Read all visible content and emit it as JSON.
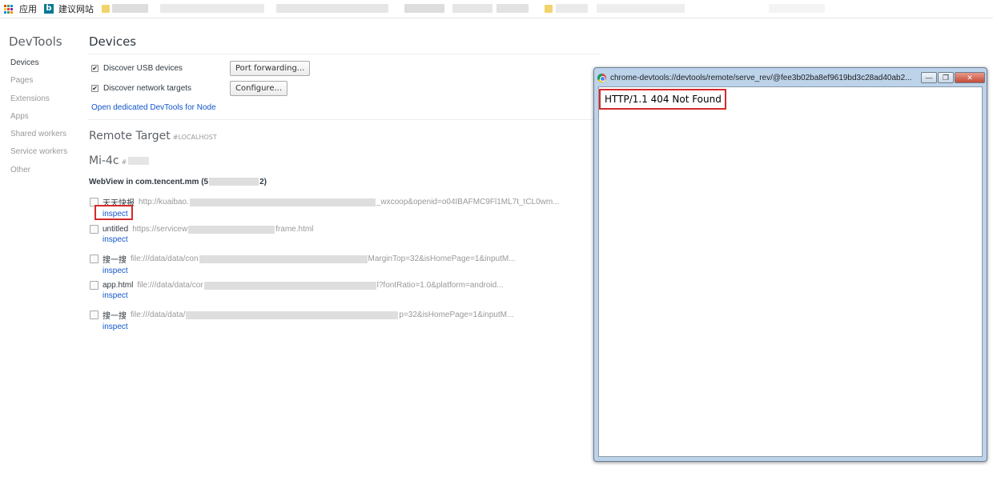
{
  "bookmarks": {
    "apps_label": "应用",
    "bing_letter": "b",
    "suggested_label": "建议网站"
  },
  "sidebar": {
    "brand": "DevTools",
    "items": [
      {
        "label": "Devices",
        "active": true
      },
      {
        "label": "Pages",
        "active": false
      },
      {
        "label": "Extensions",
        "active": false
      },
      {
        "label": "Apps",
        "active": false
      },
      {
        "label": "Shared workers",
        "active": false
      },
      {
        "label": "Service workers",
        "active": false
      },
      {
        "label": "Other",
        "active": false
      }
    ]
  },
  "main": {
    "title": "Devices",
    "discover_usb_label": "Discover USB devices",
    "discover_usb_checked": true,
    "port_forwarding_label": "Port forwarding...",
    "discover_network_label": "Discover network targets",
    "discover_network_checked": true,
    "configure_label": "Configure...",
    "open_node_link": "Open dedicated DevTools for Node",
    "remote_target_title": "Remote Target",
    "remote_target_host": "#LOCALHOST",
    "device_name": "Mi-4c",
    "device_hash": "#",
    "webview_label": "WebView in com.tencent.mm (5",
    "webview_label_end": "2)",
    "targets": [
      {
        "title": "天天快报",
        "url_start": "http://kuaibao.",
        "url_end": "_wxcoop&openid=o04IBAFMC9Fl1ML7t_tCL0wm...",
        "inspect": "inspect"
      },
      {
        "title": "untitled",
        "url_start": "https://servicew",
        "url_end": "frame.html",
        "inspect": "inspect"
      },
      {
        "title": "搜一搜",
        "url_start": "file:///data/data/con",
        "url_end": "MarginTop=32&isHomePage=1&inputM...",
        "inspect": "inspect"
      },
      {
        "title": "app.html",
        "url_start": "file:///data/data/cor",
        "url_end": "l?fontRatio=1.0&platform=android...",
        "inspect": "inspect"
      },
      {
        "title": "搜一搜",
        "url_start": "file:///data/data/",
        "url_end": "p=32&isHomePage=1&inputM...",
        "inspect": "inspect"
      }
    ]
  },
  "popup": {
    "title": "chrome-devtools://devtools/remote/serve_rev/@fee3b02ba8ef9619bd3c28ad40ab2...",
    "minimize_icon": "—",
    "restore_icon": "❐",
    "close_icon": "✕",
    "body_text": "HTTP/1.1 404 Not Found"
  },
  "colors": {
    "link": "#1155cc",
    "highlight": "#d42a2a",
    "popup_frame": "#bcd3ea"
  }
}
